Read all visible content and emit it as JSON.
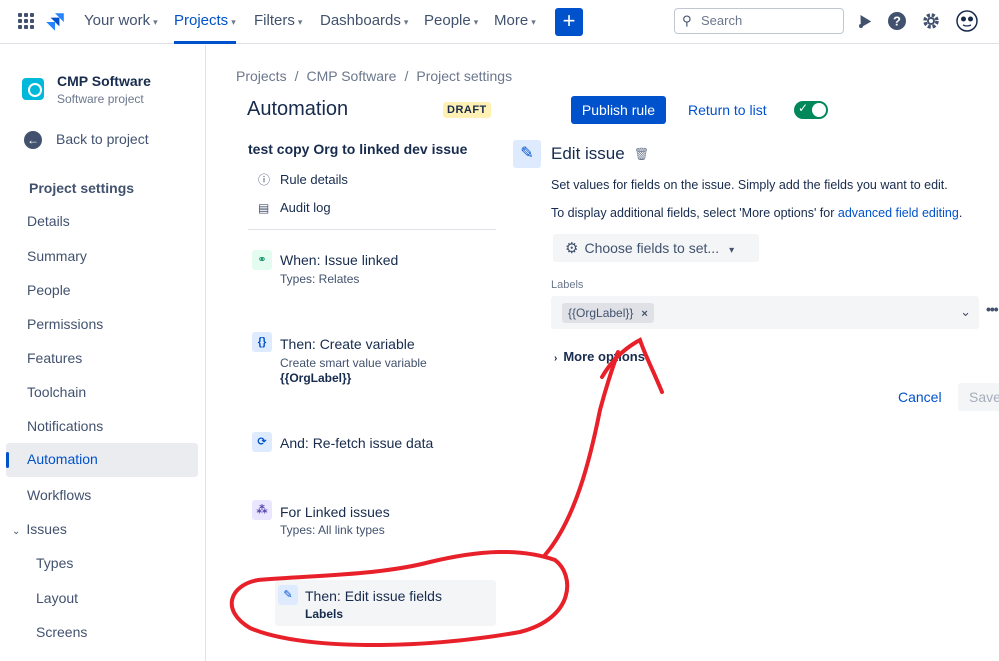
{
  "topnav": {
    "items": [
      "Your work",
      "Projects",
      "Filters",
      "Dashboards",
      "People",
      "More"
    ],
    "active": "Projects",
    "search_placeholder": "Search",
    "create_label": "+"
  },
  "project": {
    "name": "CMP Software",
    "type": "Software project"
  },
  "sidebar": {
    "back_label": "Back to project",
    "section_title": "Project settings",
    "items": [
      "Details",
      "Summary",
      "People",
      "Permissions",
      "Features",
      "Toolchain",
      "Notifications",
      "Automation",
      "Workflows"
    ],
    "active_item": "Automation",
    "issues_group": "Issues",
    "issues_children": [
      "Types",
      "Layout",
      "Screens"
    ]
  },
  "breadcrumb": [
    "Projects",
    "CMP Software",
    "Project settings"
  ],
  "header": {
    "title": "Automation",
    "badge": "DRAFT",
    "publish_label": "Publish rule",
    "return_label": "Return to list",
    "toggle_on": true
  },
  "rule": {
    "name": "test copy Org to linked dev issue",
    "links": [
      "Rule details",
      "Audit log"
    ],
    "components": [
      {
        "title": "When: Issue linked",
        "sub": "Types: Relates"
      },
      {
        "title": "Then: Create variable",
        "sub": "Create smart value variable",
        "bold": "{{OrgLabel}}"
      },
      {
        "title": "And: Re-fetch issue data"
      },
      {
        "title": "For Linked issues",
        "sub": "Types: All link types"
      },
      {
        "title": "Then: Edit issue fields",
        "bold": "Labels"
      }
    ]
  },
  "edit_panel": {
    "title": "Edit issue",
    "desc1": "Set values for fields on the issue. Simply add the fields you want to edit.",
    "desc2_prefix": "To display additional fields, select 'More options' for ",
    "desc2_link": "advanced field editing",
    "desc2_suffix": ".",
    "choose_label": "Choose fields to set...",
    "field_label": "Labels",
    "chip_value": "{{OrgLabel}}",
    "more_options": "More options",
    "cancel_label": "Cancel",
    "save_label": "Save"
  },
  "colors": {
    "accent": "#0052cc",
    "annotation": "#e8202a",
    "toggle": "#00875a"
  }
}
